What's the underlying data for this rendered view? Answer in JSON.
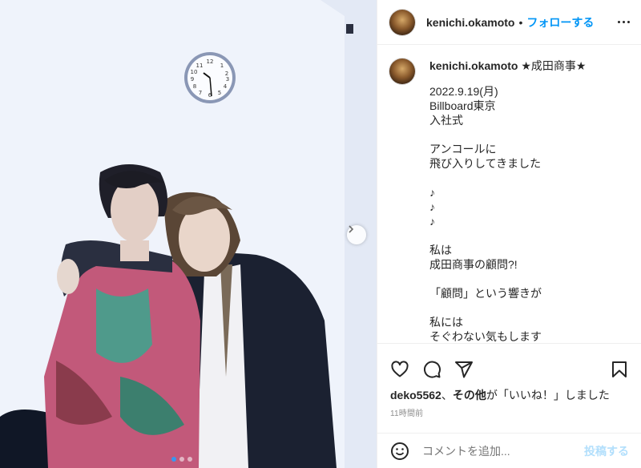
{
  "header": {
    "username": "kenichi.okamoto",
    "separator": "•",
    "follow_label": "フォローする"
  },
  "caption": {
    "username": "kenichi.okamoto",
    "title": "★成田商事★",
    "lines": [
      "2022.9.19(月)",
      "Billboard東京",
      "入社式",
      "",
      "アンコールに",
      "飛び入りしてきました",
      "",
      "♪",
      "♪",
      "♪",
      "",
      "私は",
      "成田商事の顧問?!",
      "",
      "「顧問」という響きが",
      "",
      "私には",
      "そぐわない気もします"
    ]
  },
  "likes": {
    "user": "deko5562",
    "connector": "、",
    "others": "その他",
    "suffix": "が「いいね！」しました"
  },
  "timestamp": "11時間前",
  "comment": {
    "placeholder": "コメントを追加...",
    "post_label": "投稿する"
  },
  "carousel": {
    "dots": 3,
    "active_dot": 1
  },
  "colors": {
    "accent": "#0095f6",
    "post_disabled": "#b2dffc",
    "text": "#262626",
    "muted": "#8e8e8e"
  },
  "icons": [
    "more-options-icon",
    "heart-icon",
    "comment-icon",
    "share-icon",
    "bookmark-icon",
    "emoji-icon",
    "chevron-right-icon",
    "wall-clock"
  ]
}
